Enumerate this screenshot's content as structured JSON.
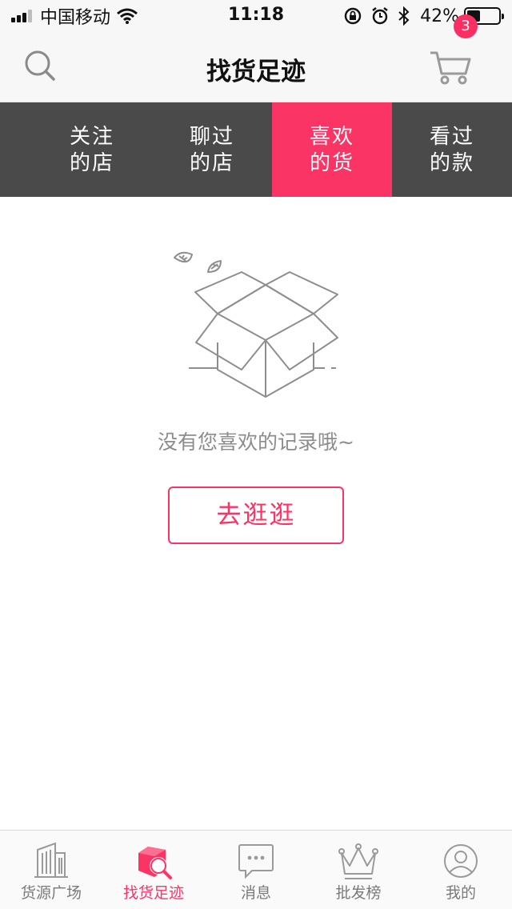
{
  "status_bar": {
    "carrier": "中国移动",
    "time": "11:18",
    "battery_percent": "42%",
    "battery_level": 0.42,
    "signal_bars": 3,
    "icons": [
      "signal-icon",
      "wifi-icon",
      "orientation-lock-icon",
      "alarm-icon",
      "bluetooth-icon",
      "battery-icon"
    ]
  },
  "header": {
    "title": "找货足迹",
    "cart_count": "3",
    "icons": [
      "search-icon",
      "cart-icon"
    ]
  },
  "tabs": [
    {
      "line1": "关注",
      "line2": "的店",
      "active": false
    },
    {
      "line1": "聊过",
      "line2": "的店",
      "active": false
    },
    {
      "line1": "喜欢",
      "line2": "的货",
      "active": true
    },
    {
      "line1": "看过",
      "line2": "的款",
      "active": false
    }
  ],
  "empty_state": {
    "message": "没有您喜欢的记录哦~",
    "button_label": "去逛逛",
    "icon": "empty-box-icon"
  },
  "bottom_nav": [
    {
      "label": "货源广场",
      "icon": "building-icon",
      "active": false
    },
    {
      "label": "找货足迹",
      "icon": "footprint-search-icon",
      "active": true
    },
    {
      "label": "消息",
      "icon": "message-icon",
      "active": false
    },
    {
      "label": "批发榜",
      "icon": "crown-icon",
      "active": false
    },
    {
      "label": "我的",
      "icon": "profile-icon",
      "active": false
    }
  ],
  "colors": {
    "accent": "#fb3466",
    "tab_bar_bg": "#4a4a4a",
    "header_bg": "#f7f7f8",
    "muted_text": "#8c8c8c"
  }
}
